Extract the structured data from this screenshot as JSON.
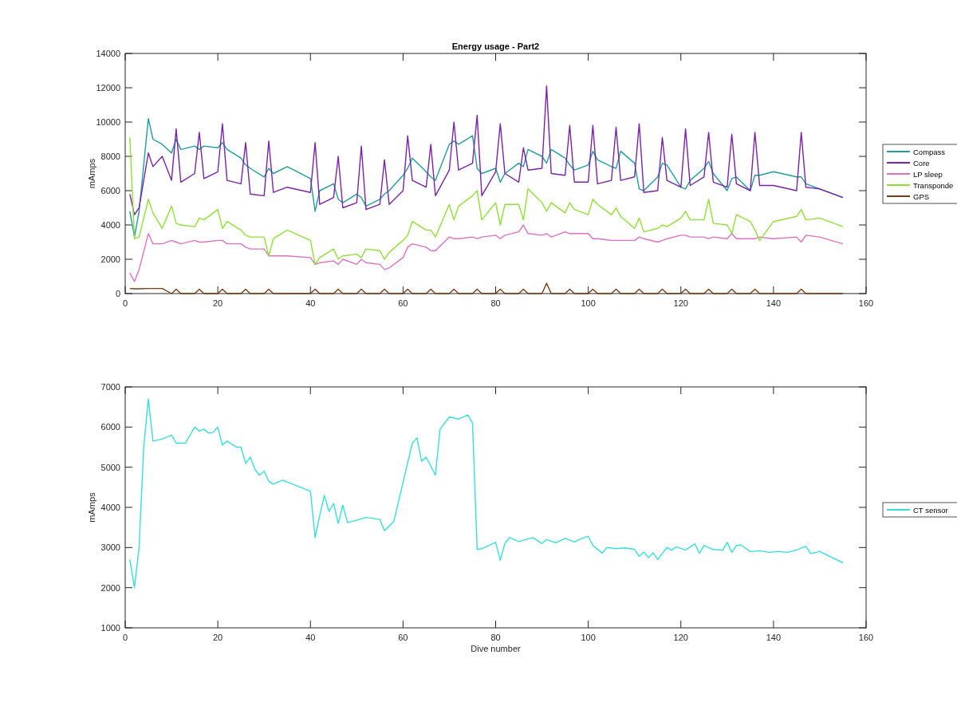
{
  "charts": [
    {
      "chart_data": {
        "type": "line",
        "legend": "right",
        "title": "Energy usage - Part2",
        "ylabel": "mAmps",
        "xlim": [
          0,
          160
        ],
        "ylim": [
          0,
          14000
        ],
        "xticks": [
          0,
          20,
          40,
          60,
          80,
          100,
          120,
          140,
          160
        ],
        "yticks": [
          0,
          2000,
          4000,
          6000,
          8000,
          10000,
          12000,
          14000
        ],
        "x": [
          1,
          2,
          3,
          5,
          6,
          8,
          10,
          11,
          12,
          15,
          16,
          17,
          20,
          21,
          22,
          25,
          26,
          27,
          30,
          31,
          32,
          35,
          40,
          41,
          42,
          45,
          46,
          47,
          50,
          51,
          52,
          55,
          56,
          57,
          60,
          61,
          62,
          65,
          66,
          67,
          70,
          71,
          72,
          75,
          76,
          77,
          80,
          81,
          82,
          85,
          86,
          87,
          90,
          91,
          92,
          95,
          96,
          97,
          100,
          101,
          102,
          105,
          106,
          107,
          110,
          111,
          112,
          115,
          116,
          117,
          120,
          121,
          122,
          125,
          126,
          127,
          130,
          131,
          132,
          135,
          136,
          137,
          140,
          145,
          146,
          147,
          150,
          155
        ],
        "series": [
          {
            "name": "Compass",
            "color": "#1f9e9e",
            "values": [
              4800,
              3300,
              4800,
              10200,
              9000,
              8700,
              8200,
              9000,
              8400,
              8600,
              8400,
              8600,
              8500,
              8800,
              8400,
              7900,
              7500,
              7300,
              6800,
              7300,
              7000,
              7400,
              6700,
              4800,
              6000,
              6400,
              5500,
              5300,
              5800,
              5600,
              5100,
              5500,
              5800,
              6000,
              6900,
              7300,
              7900,
              7100,
              6800,
              6600,
              8700,
              8900,
              8700,
              9200,
              7300,
              7000,
              7300,
              6500,
              7000,
              7600,
              7400,
              8400,
              8000,
              7600,
              8400,
              7900,
              7500,
              7200,
              7500,
              8300,
              7800,
              7400,
              7300,
              8300,
              7600,
              6100,
              6000,
              6800,
              7600,
              7500,
              6200,
              6100,
              6600,
              7300,
              7700,
              7000,
              6000,
              6700,
              6800,
              6000,
              6900,
              6900,
              7100,
              6800,
              6800,
              6400,
              6100,
              5600
            ]
          },
          {
            "name": "Core",
            "color": "#7a22a8",
            "values": [
              5800,
              4600,
              5000,
              8200,
              7400,
              8000,
              6600,
              9600,
              6500,
              7000,
              9400,
              6700,
              7100,
              9900,
              6600,
              6400,
              8800,
              5800,
              5700,
              8900,
              5900,
              6200,
              5900,
              8800,
              5200,
              5600,
              8000,
              5000,
              5300,
              8600,
              4900,
              5200,
              7800,
              5200,
              6000,
              9200,
              6600,
              6200,
              8700,
              5700,
              7200,
              10000,
              7200,
              7600,
              10400,
              5700,
              7100,
              9900,
              7000,
              6500,
              8500,
              7200,
              7300,
              12100,
              7000,
              6900,
              9800,
              6500,
              6500,
              9800,
              6400,
              6600,
              9700,
              6600,
              6800,
              9900,
              5900,
              6000,
              9100,
              6600,
              6200,
              9600,
              6300,
              6800,
              9400,
              6500,
              6200,
              9300,
              6400,
              6000,
              9400,
              6300,
              6300,
              6000,
              9400,
              6200,
              6100,
              5600
            ]
          },
          {
            "name": "LP sleep",
            "color": "#e070c0",
            "values": [
              1200,
              700,
              1400,
              3500,
              2900,
              2900,
              3100,
              3000,
              2900,
              3100,
              3000,
              3000,
              3100,
              3100,
              2900,
              2900,
              2700,
              2600,
              2600,
              2200,
              2200,
              2200,
              2100,
              1700,
              1800,
              1900,
              1700,
              2000,
              1700,
              2000,
              1800,
              1700,
              1400,
              1500,
              2100,
              2700,
              2900,
              2700,
              2500,
              2500,
              3300,
              3200,
              3200,
              3300,
              3200,
              3300,
              3400,
              3200,
              3400,
              3600,
              4000,
              3500,
              3400,
              3500,
              3300,
              3600,
              3500,
              3500,
              3500,
              3200,
              3200,
              3100,
              3100,
              3100,
              3100,
              3300,
              3200,
              3000,
              3100,
              3200,
              3400,
              3400,
              3300,
              3300,
              3200,
              3300,
              3200,
              3500,
              3200,
              3200,
              3200,
              3300,
              3200,
              3300,
              3000,
              3400,
              3300,
              2900
            ]
          },
          {
            "name": "Transponde",
            "color": "#8ee034",
            "values": [
              9100,
              3200,
              3300,
              5500,
              4700,
              3800,
              5100,
              4100,
              4000,
              3900,
              4400,
              4300,
              4900,
              3800,
              4200,
              3700,
              3400,
              3300,
              3300,
              2200,
              3200,
              3700,
              3100,
              1700,
              2100,
              2600,
              2000,
              2200,
              2300,
              2100,
              2600,
              2500,
              2000,
              2400,
              3100,
              3400,
              4200,
              3700,
              3700,
              3300,
              5200,
              4300,
              5100,
              5700,
              6000,
              4300,
              5300,
              4000,
              5200,
              5200,
              4300,
              6100,
              5300,
              4800,
              5300,
              4700,
              5300,
              4900,
              4600,
              5500,
              5200,
              4600,
              5000,
              4500,
              3800,
              4400,
              3600,
              3800,
              4000,
              3900,
              4400,
              4800,
              4300,
              4300,
              5500,
              4100,
              4000,
              3500,
              4600,
              4200,
              3700,
              3100,
              4200,
              4500,
              4900,
              4300,
              4400,
              3900
            ]
          },
          {
            "name": "GPS",
            "color": "#7a3d12",
            "values": [
              300,
              280,
              280,
              300,
              300,
              300,
              0,
              250,
              0,
              0,
              250,
              0,
              0,
              250,
              0,
              0,
              250,
              0,
              0,
              250,
              0,
              0,
              0,
              250,
              0,
              0,
              250,
              0,
              0,
              250,
              0,
              0,
              250,
              0,
              0,
              250,
              0,
              0,
              250,
              0,
              0,
              250,
              0,
              0,
              250,
              0,
              0,
              250,
              0,
              0,
              250,
              0,
              0,
              600,
              0,
              0,
              250,
              0,
              0,
              250,
              0,
              0,
              250,
              0,
              0,
              250,
              0,
              0,
              250,
              0,
              0,
              250,
              0,
              0,
              250,
              0,
              0,
              250,
              0,
              0,
              250,
              0,
              0,
              0,
              250,
              0,
              0,
              0
            ]
          }
        ]
      }
    },
    {
      "chart_data": {
        "type": "line",
        "legend": "right",
        "xlabel": "Dive number",
        "ylabel": "mAmps",
        "xlim": [
          0,
          160
        ],
        "ylim": [
          1000,
          7000
        ],
        "xticks": [
          0,
          20,
          40,
          60,
          80,
          100,
          120,
          140,
          160
        ],
        "yticks": [
          1000,
          2000,
          3000,
          4000,
          5000,
          6000,
          7000
        ],
        "x": [
          1,
          2,
          3,
          4,
          5,
          6,
          8,
          10,
          11,
          13,
          15,
          16,
          17,
          18,
          19,
          20,
          21,
          22,
          24,
          25,
          26,
          27,
          28,
          29,
          30,
          31,
          32,
          34,
          40,
          41,
          42,
          43,
          44,
          45,
          46,
          47,
          48,
          50,
          52,
          55,
          56,
          58,
          62,
          63,
          64,
          65,
          67,
          68,
          70,
          72,
          74,
          75,
          76,
          77,
          80,
          81,
          82,
          83,
          85,
          88,
          90,
          91,
          93,
          95,
          97,
          98,
          100,
          101,
          103,
          104,
          106,
          108,
          110,
          111,
          112,
          113,
          114,
          115,
          117,
          118,
          119,
          121,
          123,
          124,
          125,
          127,
          129,
          130,
          131,
          132,
          133,
          135,
          137,
          139,
          141,
          143,
          145,
          147,
          148,
          150,
          155
        ],
        "series": [
          {
            "name": "CT sensor",
            "color": "#35e0dc",
            "values": [
              2700,
              2000,
              3000,
              5500,
              6700,
              5650,
              5700,
              5800,
              5600,
              5600,
              6000,
              5900,
              5950,
              5850,
              5870,
              6000,
              5550,
              5650,
              5500,
              5500,
              5100,
              5250,
              4950,
              4800,
              4900,
              4650,
              4580,
              4680,
              4400,
              3250,
              3800,
              4300,
              3900,
              4100,
              3600,
              4050,
              3620,
              3680,
              3750,
              3700,
              3420,
              3650,
              5600,
              5730,
              5150,
              5250,
              4800,
              5950,
              6250,
              6200,
              6300,
              6100,
              2950,
              2970,
              3130,
              2680,
              3100,
              3250,
              3150,
              3250,
              3100,
              3200,
              3120,
              3230,
              3140,
              3200,
              3280,
              3050,
              2860,
              3000,
              2970,
              2990,
              2950,
              2780,
              2890,
              2750,
              2870,
              2700,
              3000,
              2930,
              3020,
              2940,
              3090,
              2860,
              3050,
              2950,
              2930,
              3130,
              2880,
              3050,
              3060,
              2900,
              2920,
              2880,
              2900,
              2880,
              2940,
              3030,
              2850,
              2900,
              2620
            ]
          }
        ]
      }
    }
  ]
}
